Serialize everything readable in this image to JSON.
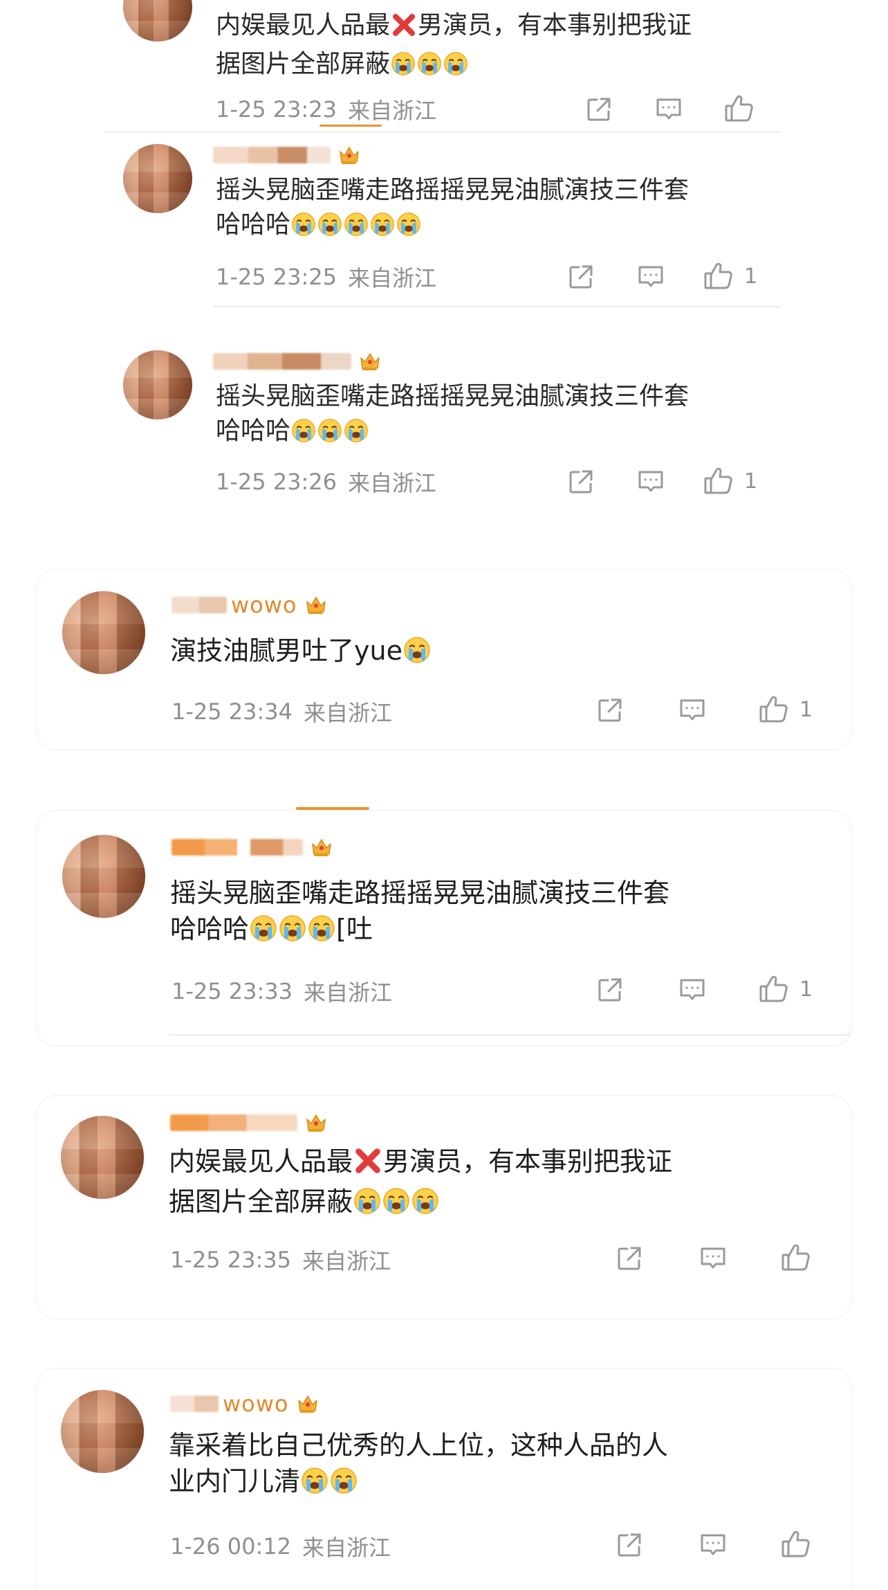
{
  "comments": [
    {
      "user_suffix": "",
      "text_line1": "内娱最见人品最",
      "text_line1_after": "男演员，有本事别把我证",
      "text_line2": "据图片全部屏蔽",
      "time": "1-25 23:23",
      "location": "来自浙江",
      "likes": ""
    },
    {
      "user_suffix": "",
      "text_line1": "摇头晃脑歪嘴走路摇摇晃晃油腻演技三件套",
      "text_line2": "哈哈哈",
      "time": "1-25 23:25",
      "location": "来自浙江",
      "likes": "1"
    },
    {
      "user_suffix": "",
      "text_line1": "摇头晃脑歪嘴走路摇摇晃晃油腻演技三件套",
      "text_line2": "哈哈哈",
      "time": "1-25 23:26",
      "location": "来自浙江",
      "likes": "1"
    },
    {
      "user_suffix": "wowo",
      "text_line1": "演技油腻男吐了yue",
      "text_line2": "",
      "time": "1-25 23:34",
      "location": "来自浙江",
      "likes": "1"
    },
    {
      "user_suffix": "",
      "text_line1": "摇头晃脑歪嘴走路摇摇晃晃油腻演技三件套",
      "text_line2": "哈哈哈",
      "text_line2_after": "[吐",
      "time": "1-25 23:33",
      "location": "来自浙江",
      "likes": "1"
    },
    {
      "user_suffix": "",
      "text_line1": "内娱最见人品最",
      "text_line1_after": "男演员，有本事别把我证",
      "text_line2": "据图片全部屏蔽",
      "time": "1-25 23:35",
      "location": "来自浙江",
      "likes": ""
    },
    {
      "user_suffix": "wowo",
      "text_line1": "靠采着比自己优秀的人上位，这种人品的人",
      "text_line2": "业内门儿清",
      "time": "1-26 00:12",
      "location": "来自浙江",
      "likes": ""
    }
  ],
  "icons": {
    "share": "share-icon",
    "comment": "comment-icon",
    "like": "thumbs-up-icon",
    "badge": "crown-badge-icon",
    "emoji": "crying-face-emoji",
    "cross": "red-cross-emoji"
  },
  "colors": {
    "accent": "#f0922e",
    "meta": "#8f8f8f",
    "text": "#1e1e1e",
    "cross": "#e23b3b"
  }
}
